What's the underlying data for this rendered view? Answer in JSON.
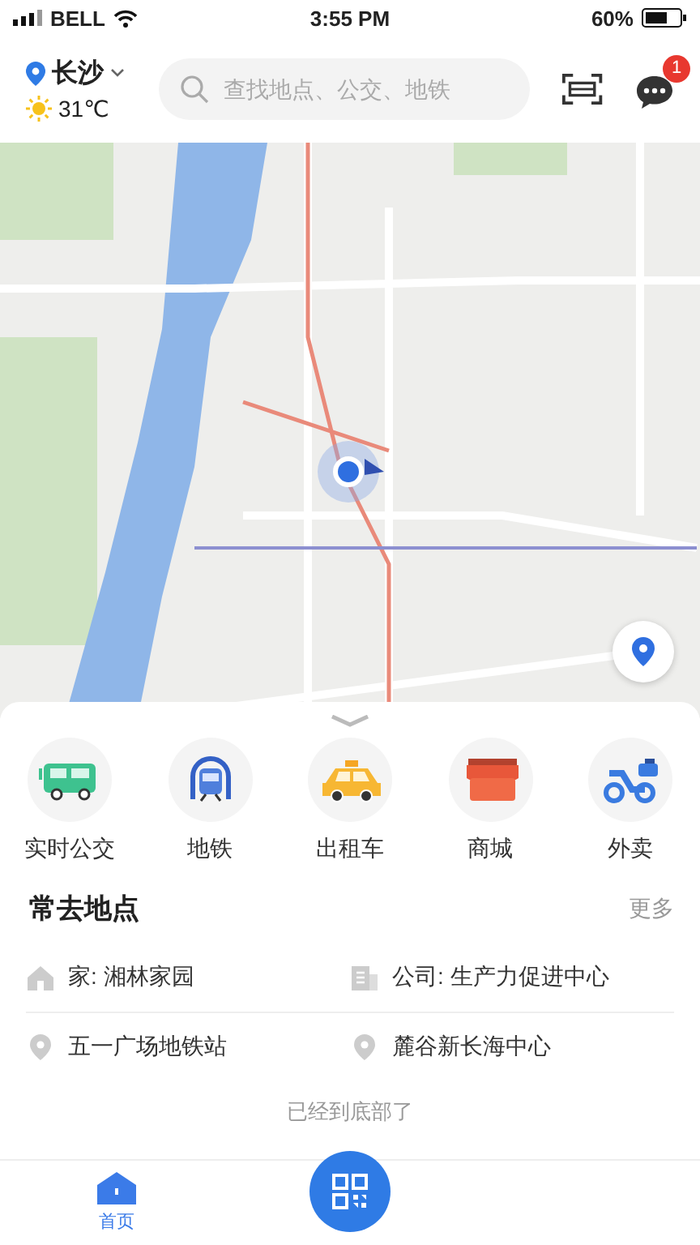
{
  "status_bar": {
    "carrier": "BELL",
    "time": "3:55 PM",
    "battery": "60%"
  },
  "header": {
    "city": "长沙",
    "temperature": "31℃",
    "search": {
      "placeholder": "查找地点、公交、地铁"
    },
    "message_badge": "1"
  },
  "services": [
    {
      "label": "实时公交",
      "kind": "bus"
    },
    {
      "label": "地铁",
      "kind": "metro"
    },
    {
      "label": "出租车",
      "kind": "taxi"
    },
    {
      "label": "商城",
      "kind": "shop"
    },
    {
      "label": "外卖",
      "kind": "delivery"
    }
  ],
  "frequent_places": {
    "title": "常去地点",
    "more": "更多",
    "items": [
      {
        "kind": "home",
        "label": "家: 湘林家园"
      },
      {
        "kind": "work",
        "label": "公司: 生产力促进中心"
      },
      {
        "kind": "pin",
        "label": "五一广场地铁站"
      },
      {
        "kind": "pin",
        "label": "麓谷新长海中心"
      }
    ]
  },
  "footer_note": "已经到底部了",
  "tab_bar": {
    "tabs": [
      {
        "label": "首页",
        "selected": true
      }
    ]
  }
}
